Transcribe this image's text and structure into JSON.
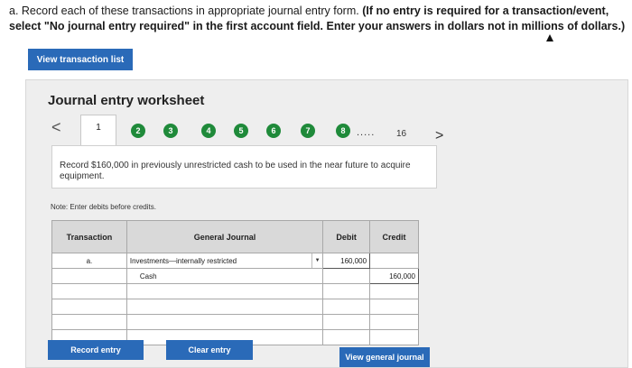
{
  "instructions": {
    "normal": "a. Record each of these transactions in appropriate journal entry form. ",
    "bold": "(If no entry is required for a transaction/event, select \"No journal entry required\" in the first account field. Enter your answers in dollars not in millions of dollars.)"
  },
  "view_transaction_list_label": "View transaction list",
  "worksheet": {
    "title": "Journal entry worksheet",
    "nav_prev": "<",
    "nav_next": ">",
    "active_step": "1",
    "steps": [
      "2",
      "3",
      "4",
      "5",
      "6",
      "7",
      "8"
    ],
    "dots": ".....",
    "last_step": "16",
    "description": "Record $160,000 in previously unrestricted cash to be used in the near future to acquire equipment.",
    "note": "Note: Enter debits before credits."
  },
  "journal": {
    "headers": {
      "transaction": "Transaction",
      "general_journal": "General Journal",
      "debit": "Debit",
      "credit": "Credit"
    },
    "rows": [
      {
        "transaction": "a.",
        "account": "Investments—internally restricted",
        "debit": "160,000",
        "credit": ""
      },
      {
        "transaction": "",
        "account": "Cash",
        "debit": "",
        "credit": "160,000"
      },
      {
        "transaction": "",
        "account": "",
        "debit": "",
        "credit": ""
      },
      {
        "transaction": "",
        "account": "",
        "debit": "",
        "credit": ""
      },
      {
        "transaction": "",
        "account": "",
        "debit": "",
        "credit": ""
      },
      {
        "transaction": "",
        "account": "",
        "debit": "",
        "credit": ""
      }
    ]
  },
  "buttons": {
    "record_entry": "Record entry",
    "clear_entry": "Clear entry",
    "view_general_journal": "View general journal"
  },
  "colors": {
    "button_blue": "#2a6ab8",
    "step_green": "#1f8a3a"
  }
}
